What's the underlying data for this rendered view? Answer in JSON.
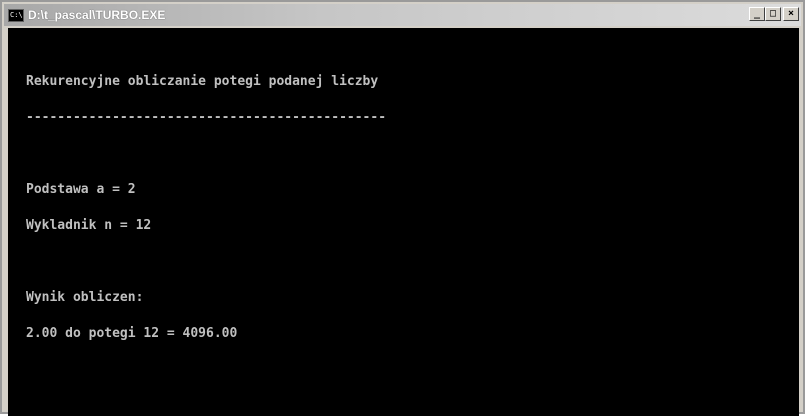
{
  "window": {
    "title": "D:\\t_pascal\\TURBO.EXE",
    "icon_label": "C:\\",
    "controls": {
      "minimize_label": "_",
      "maximize_label": "□",
      "close_label": "×"
    }
  },
  "console": {
    "heading": "Rekurencyjne obliczanie potegi podanej liczby",
    "separator": "----------------------------------------------",
    "base_line": "Podstawa a = 2",
    "exponent_line": "Wykladnik n = 12",
    "result_label": "Wynik obliczen:",
    "result_line": "2.00 do potegi 12 = 4096.00"
  },
  "colors": {
    "console_background": "#000000",
    "console_text": "#c0c0c0",
    "titlebar": "#b0b0b0"
  }
}
